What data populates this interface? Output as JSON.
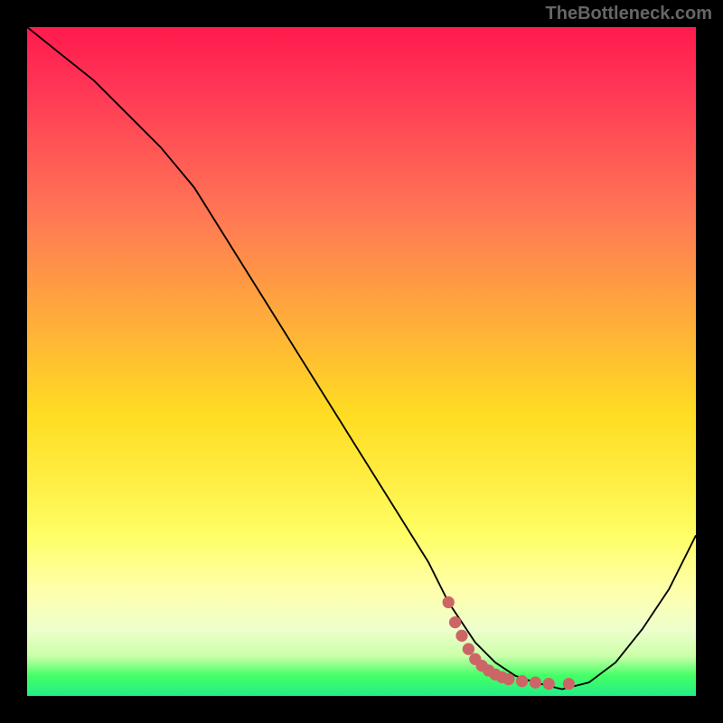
{
  "watermark": "TheBottleneck.com",
  "chart_data": {
    "type": "line",
    "title": "",
    "xlabel": "",
    "ylabel": "",
    "xlim": [
      0,
      100
    ],
    "ylim": [
      0,
      100
    ],
    "series": [
      {
        "name": "bottleneck-curve",
        "x": [
          0,
          5,
          10,
          15,
          20,
          25,
          30,
          35,
          40,
          45,
          50,
          55,
          60,
          63,
          67,
          70,
          73,
          76,
          80,
          84,
          88,
          92,
          96,
          100
        ],
        "values": [
          100,
          96,
          92,
          87,
          82,
          76,
          68,
          60,
          52,
          44,
          36,
          28,
          20,
          14,
          8,
          5,
          3,
          2,
          1,
          2,
          5,
          10,
          16,
          24
        ]
      }
    ],
    "markers": {
      "name": "highlighted-points",
      "color": "#cc6666",
      "points": [
        {
          "x": 63,
          "y": 14
        },
        {
          "x": 64,
          "y": 11
        },
        {
          "x": 65,
          "y": 9
        },
        {
          "x": 66,
          "y": 7
        },
        {
          "x": 67,
          "y": 5.5
        },
        {
          "x": 68,
          "y": 4.5
        },
        {
          "x": 69,
          "y": 3.8
        },
        {
          "x": 70,
          "y": 3.2
        },
        {
          "x": 71,
          "y": 2.8
        },
        {
          "x": 72,
          "y": 2.5
        },
        {
          "x": 74,
          "y": 2.2
        },
        {
          "x": 76,
          "y": 2.0
        },
        {
          "x": 78,
          "y": 1.8
        },
        {
          "x": 81,
          "y": 1.8
        }
      ]
    }
  },
  "colors": {
    "background": "#000000",
    "curve": "#000000",
    "marker": "#cc6666"
  }
}
